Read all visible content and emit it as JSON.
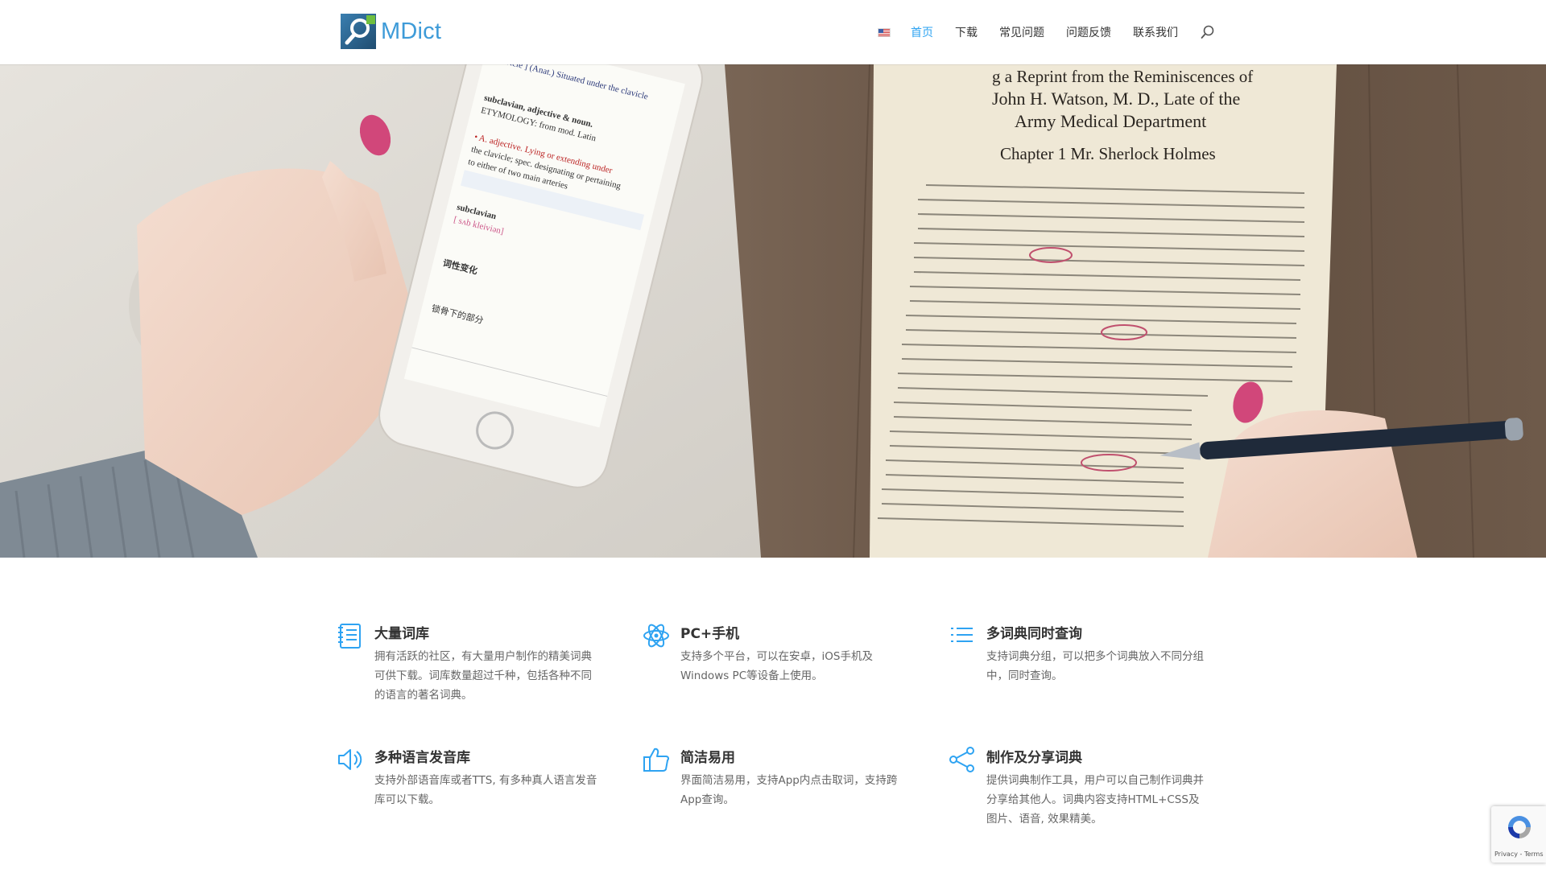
{
  "header": {
    "logo_text": "MDict",
    "nav": {
      "language_flag": "us-flag-icon",
      "items": [
        "首页",
        "下载",
        "常见问题",
        "问题反馈",
        "联系我们"
      ],
      "active_index": 0
    },
    "colors": {
      "accent": "#2ea3f2",
      "logo": "#3e9bd8"
    }
  },
  "hero": {
    "book_heading_line1": "John H. Watson, M. D., Late of the",
    "book_heading_line2": "Army Medical Department",
    "book_top": "g a Reprint from the Reminiscences of",
    "chapter": "Chapter 1  Mr. Sherlock Holmes"
  },
  "features": [
    {
      "icon": "book-list-icon",
      "title": "大量词库",
      "desc": "拥有活跃的社区，有大量用户制作的精美词典可供下载。词库数量超过千种，包括各种不同的语言的著名词典。"
    },
    {
      "icon": "atom-icon",
      "title": "PC+手机",
      "desc": "支持多个平台，可以在安卓，iOS手机及Windows PC等设备上使用。"
    },
    {
      "icon": "list-icon",
      "title": "多词典同时查询",
      "desc": "支持词典分组，可以把多个词典放入不同分组中，同时查询。"
    },
    {
      "icon": "speaker-icon",
      "title": "多种语言发音库",
      "desc": "支持外部语音库或者TTS, 有多种真人语言发音库可以下载。"
    },
    {
      "icon": "thumbs-up-icon",
      "title": "简洁易用",
      "desc": "界面简洁易用，支持App内点击取词，支持跨App查询。"
    },
    {
      "icon": "share-icon",
      "title": "制作及分享词典",
      "desc": "提供词典制作工具，用户可以自己制作词典并分享给其他人。词典内容支持HTML+CSS及图片、语音, 效果精美。"
    }
  ],
  "recaptcha": {
    "links": "Privacy - Terms"
  }
}
